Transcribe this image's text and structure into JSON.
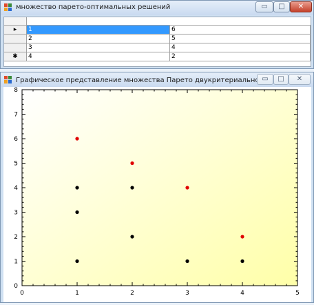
{
  "window1": {
    "title": "множество парето-оптимальных решений",
    "minimize_glyph": "▭",
    "maximize_glyph": "□",
    "close_glyph": "✕",
    "rows": [
      {
        "marker": "▸",
        "a": "1",
        "b": "6"
      },
      {
        "marker": "",
        "a": "2",
        "b": "5"
      },
      {
        "marker": "",
        "a": "3",
        "b": "4"
      },
      {
        "marker": "✱",
        "a": "4",
        "b": "2"
      }
    ],
    "selected_color": "#3399ff"
  },
  "window2": {
    "title": "Графическое представление множества Парето двукритериальной задачи",
    "minimize_glyph": "▭",
    "maximize_glyph": "□",
    "close_glyph": "✕"
  },
  "chart_data": {
    "type": "scatter",
    "xlim": [
      0,
      5
    ],
    "ylim": [
      0,
      8
    ],
    "x_ticks": [
      "0",
      "1",
      "2",
      "3",
      "4",
      "5"
    ],
    "y_ticks": [
      "0",
      "1",
      "2",
      "3",
      "4",
      "5",
      "6",
      "7",
      "8"
    ],
    "background": "light yellow gradient",
    "series": [
      {
        "color": "#000000",
        "points": [
          [
            1,
            1
          ],
          [
            1,
            3
          ],
          [
            1,
            4
          ],
          [
            2,
            2
          ],
          [
            2,
            4
          ],
          [
            3,
            1
          ],
          [
            4,
            1
          ]
        ]
      },
      {
        "color": "#e00000",
        "points": [
          [
            1,
            6
          ],
          [
            2,
            5
          ],
          [
            3,
            4
          ],
          [
            4,
            2
          ]
        ]
      }
    ]
  }
}
